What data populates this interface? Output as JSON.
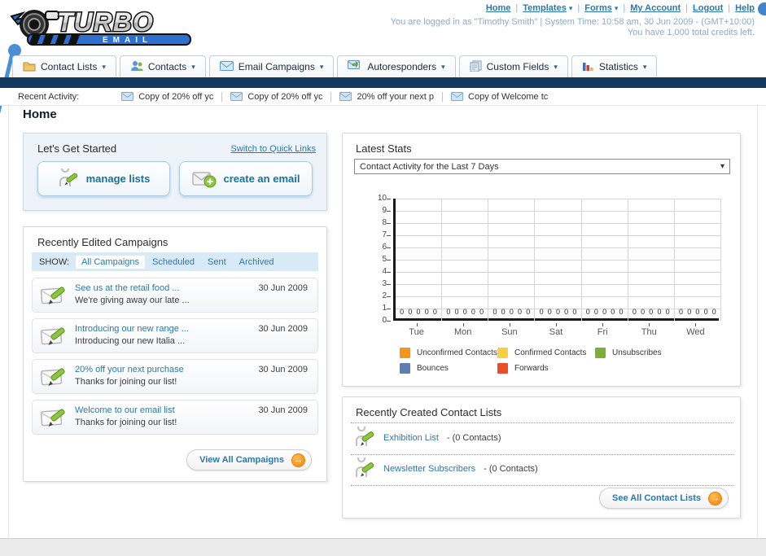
{
  "header": {
    "logo_title": "TURBO",
    "logo_subtitle": "E M A I L",
    "nav_links": [
      {
        "label": "Home",
        "menu": false
      },
      {
        "label": "Templates",
        "menu": true
      },
      {
        "label": "Forms",
        "menu": true
      },
      {
        "label": "My Account",
        "menu": false
      },
      {
        "label": "Logout",
        "menu": false
      },
      {
        "label": "Help",
        "menu": false
      }
    ],
    "nav_separator": "|",
    "login_line1": "You are logged in as \"Timothy Smith\" | System Time: 10:58 am, 30 Jun 2009 - (GMT+10:00)",
    "login_line2": "You have 1,000 total credits left."
  },
  "tabs": [
    {
      "label": "Contact Lists",
      "icon": "folder-icon"
    },
    {
      "label": "Contacts",
      "icon": "people-icon"
    },
    {
      "label": "Email Campaigns",
      "icon": "envelope-icon"
    },
    {
      "label": "Autoresponders",
      "icon": "envelope-arrow-icon"
    },
    {
      "label": "Custom Fields",
      "icon": "pages-icon"
    },
    {
      "label": "Statistics",
      "icon": "barchart-icon"
    }
  ],
  "recent_activity": {
    "label": "Recent Activity:",
    "items": [
      "Copy of 20% off yc",
      "Copy of 20% off yc",
      "20% off your next p",
      "Copy of Welcome tc"
    ]
  },
  "page_title": "Home",
  "get_started": {
    "title": "Let's Get Started",
    "switch_link": "Switch to Quick Links",
    "manage_lists_label": "manage lists",
    "create_email_label": "create an email"
  },
  "campaigns": {
    "title": "Recently Edited Campaigns",
    "show_label": "SHOW:",
    "filters": [
      "All Campaigns",
      "Scheduled",
      "Sent",
      "Archived"
    ],
    "selected_filter": "All Campaigns",
    "rows": [
      {
        "title": "See us at the retail food ...",
        "subtitle": "We're giving away our late ...",
        "date": "30 Jun 2009"
      },
      {
        "title": "Introducing our new range ...",
        "subtitle": "Introducing our new Italia ...",
        "date": "30 Jun 2009"
      },
      {
        "title": "20% off your next purchase",
        "subtitle": "Thanks for joining our list!",
        "date": "30 Jun 2009"
      },
      {
        "title": "Welcome to our email list",
        "subtitle": "Thanks for joining our list!",
        "date": "30 Jun 2009"
      }
    ],
    "view_all_label": "View All Campaigns"
  },
  "stats": {
    "title": "Latest Stats",
    "selected_report": "Contact Activity for the Last 7 Days"
  },
  "chart_data": {
    "type": "bar",
    "title": "Contact Activity for the Last 7 Days",
    "categories": [
      "Tue",
      "Mon",
      "Sun",
      "Sat",
      "Fri",
      "Thu",
      "Wed"
    ],
    "series": [
      {
        "name": "Unconfirmed Contacts",
        "color": "#F5941F",
        "values": [
          0,
          0,
          0,
          0,
          0,
          0,
          0
        ]
      },
      {
        "name": "Confirmed Contacts",
        "color": "#F8CF40",
        "values": [
          0,
          0,
          0,
          0,
          0,
          0,
          0
        ]
      },
      {
        "name": "Unsubscribes",
        "color": "#7CAE3B",
        "values": [
          0,
          0,
          0,
          0,
          0,
          0,
          0
        ]
      },
      {
        "name": "Bounces",
        "color": "#5E7DB2",
        "values": [
          0,
          0,
          0,
          0,
          0,
          0,
          0
        ]
      },
      {
        "name": "Forwards",
        "color": "#E94E2B",
        "values": [
          0,
          0,
          0,
          0,
          0,
          0,
          0
        ]
      }
    ],
    "ylim": [
      0,
      10
    ],
    "ytick_step": 1,
    "grid": true,
    "legend_position": "bottom",
    "data_labels_shown": true
  },
  "contact_lists": {
    "title": "Recently Created Contact Lists",
    "items": [
      {
        "name": "Exhibition List",
        "suffix": " - (0 Contacts)"
      },
      {
        "name": "Newsletter Subscribers",
        "suffix": " - (0 Contacts)"
      }
    ],
    "see_all_label": "See All Contact Lists"
  },
  "colors": {
    "navy_bar": "#15395e",
    "link_blue": "#2a78ad",
    "button_text": "#19719a",
    "orange_accent": "#f7941e"
  }
}
